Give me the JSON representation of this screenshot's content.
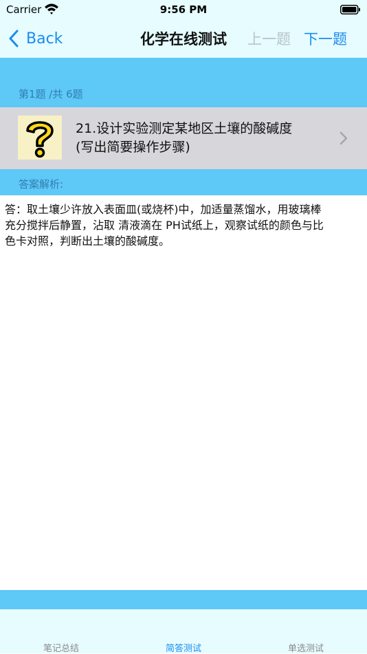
{
  "status_bar": {
    "carrier": "Carrier",
    "time": "9:56 PM"
  },
  "nav": {
    "back_label": "Back",
    "title": "化学在线测试",
    "prev_label": "上一题",
    "next_label": "下一题"
  },
  "question": {
    "progress": "第1题 /共 6题",
    "text_line1": "21.设计实验测定某地区土壤的酸碱度",
    "text_line2": "(写出简要操作步骤)",
    "icon": "question-mark-icon"
  },
  "answer": {
    "header": "答案解析:",
    "line1": "答：取土壤少许放入表面皿(或烧杯)中，加适量蒸馏水，用玻璃棒",
    "line2": "充分搅拌后静置，沾取 清液滴在 PH试纸上，观察试纸的颜色与比",
    "line3": "色卡对照，判断出土壤的酸碱度。"
  },
  "tabs": [
    {
      "label": "笔记总结",
      "active": false
    },
    {
      "label": "简答测试",
      "active": true
    },
    {
      "label": "单选测试",
      "active": false
    }
  ],
  "colors": {
    "accent": "#1a8cf0",
    "band": "#5ec8f7",
    "header_bg": "#e6fcff",
    "question_bg": "#d7d6db"
  }
}
